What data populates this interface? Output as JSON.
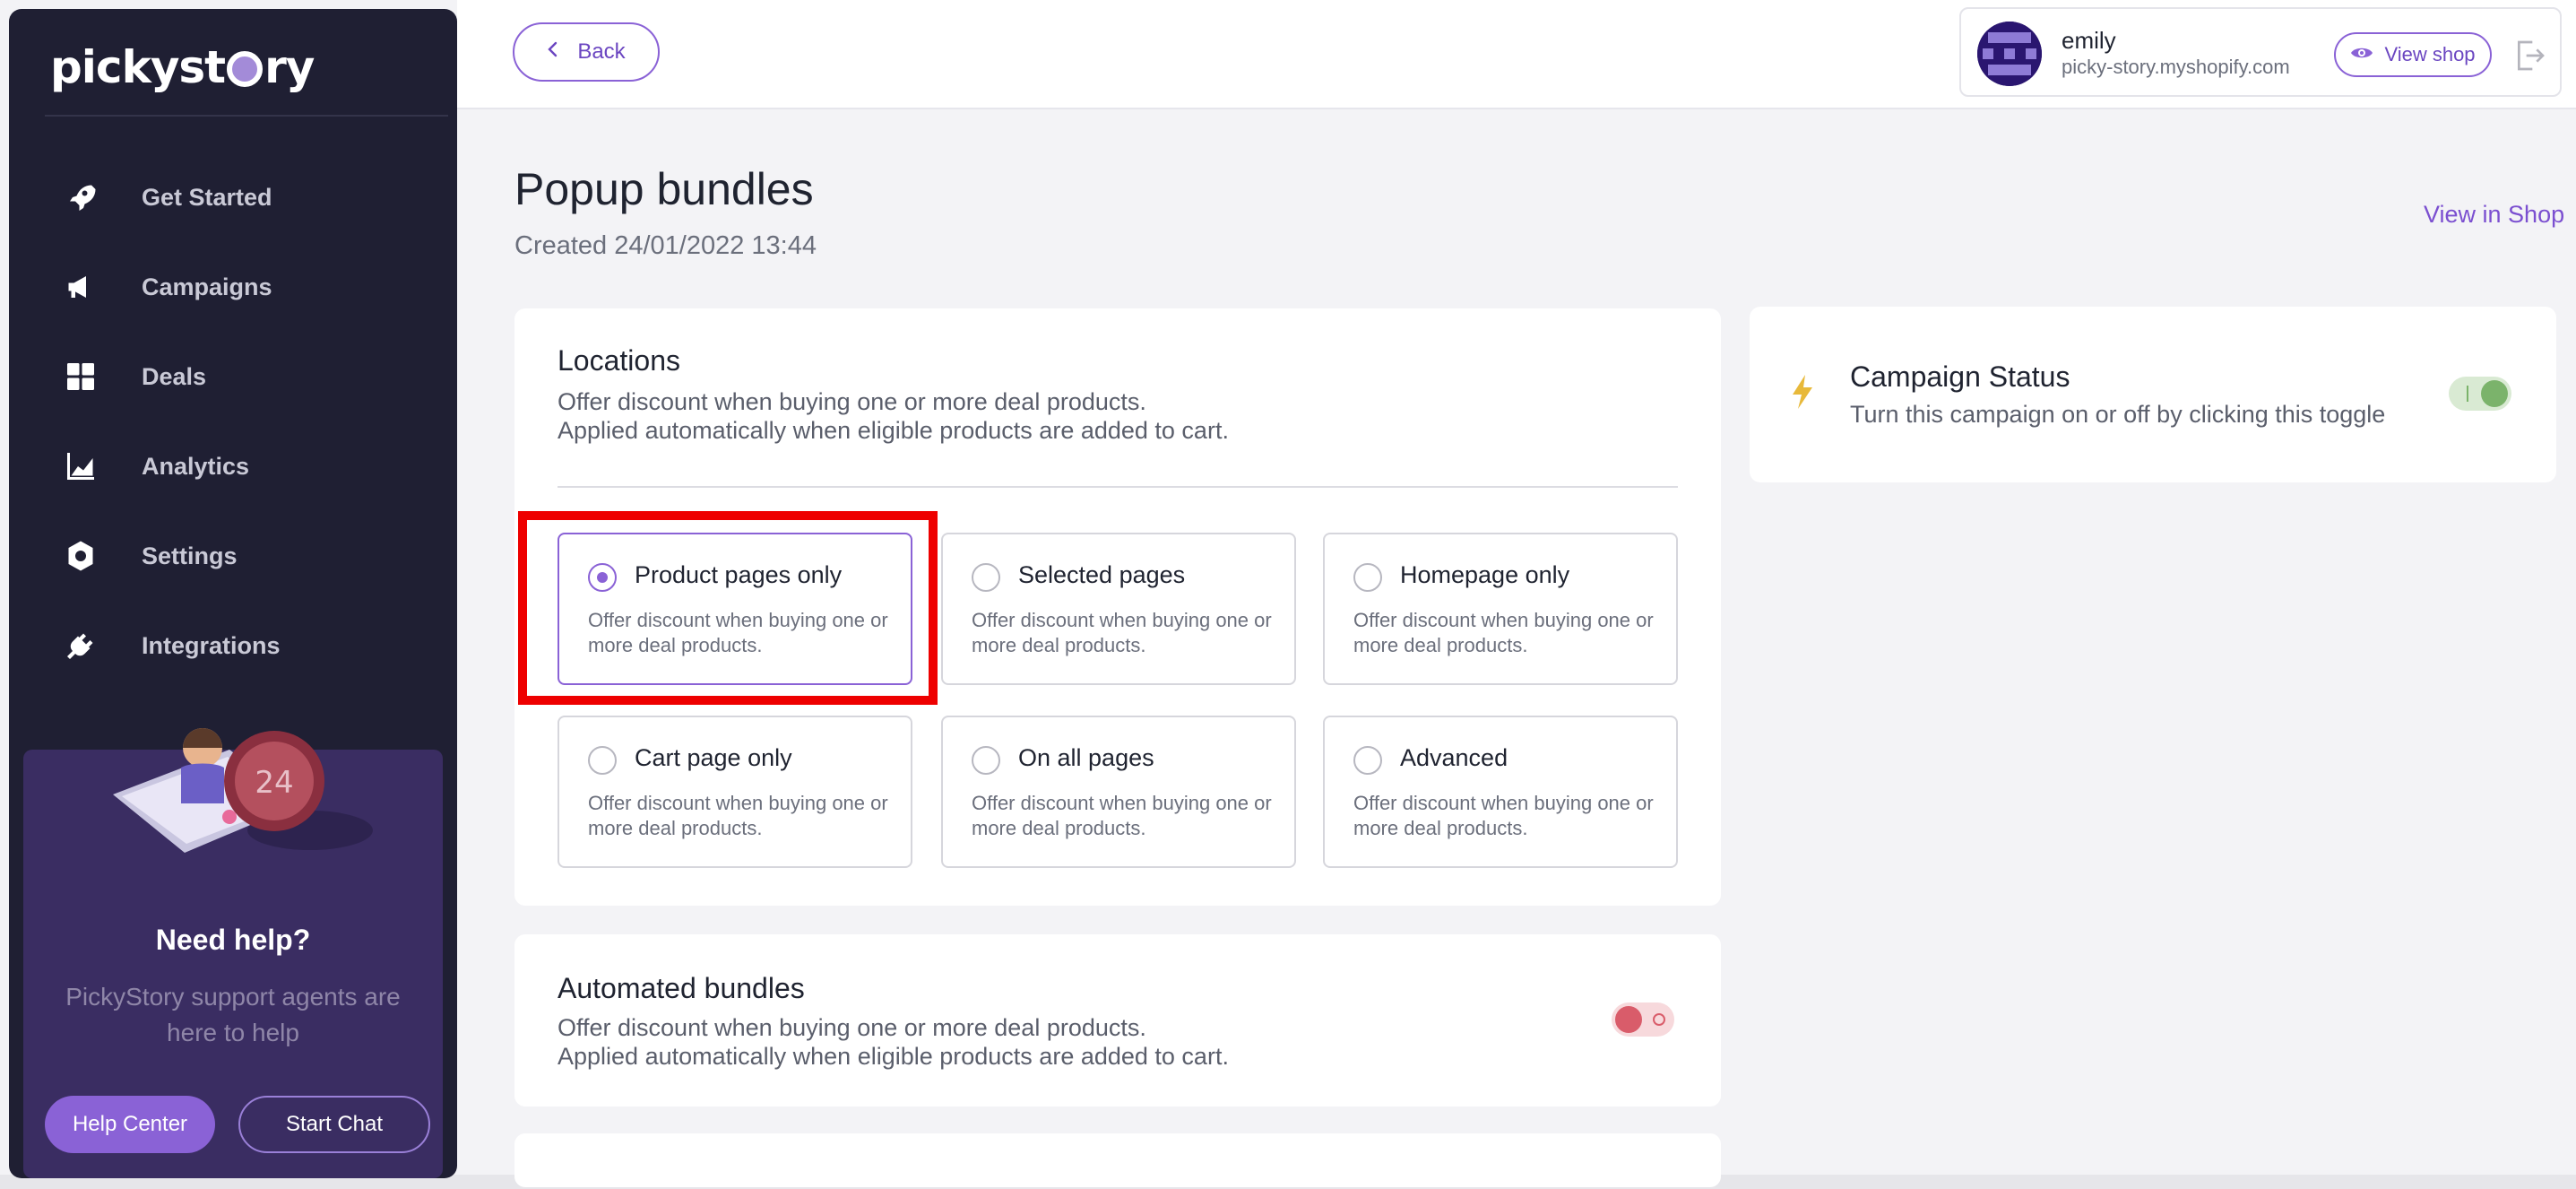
{
  "app": {
    "logo_text_left": "pickyst",
    "logo_text_right": "ry"
  },
  "sidebar": {
    "items": [
      {
        "label": "Get Started",
        "icon": "rocket-icon"
      },
      {
        "label": "Campaigns",
        "icon": "megaphone-icon"
      },
      {
        "label": "Deals",
        "icon": "grid-icon"
      },
      {
        "label": "Analytics",
        "icon": "chart-icon"
      },
      {
        "label": "Settings",
        "icon": "gear-icon"
      },
      {
        "label": "Integrations",
        "icon": "plug-icon"
      }
    ],
    "help": {
      "title": "Need help?",
      "subtitle": "PickyStory support agents are here to help",
      "help_center_label": "Help Center",
      "start_chat_label": "Start Chat"
    }
  },
  "header": {
    "back_label": "Back",
    "user": {
      "name": "emily",
      "shop": "picky-story.myshopify.com",
      "view_shop_label": "View shop"
    }
  },
  "page": {
    "title": "Popup bundles",
    "created": "Created 24/01/2022 13:44",
    "view_in_shop_label": "View in Shop"
  },
  "locations": {
    "title": "Locations",
    "desc_line1": "Offer discount when buying one or more deal products.",
    "desc_line2": "Applied automatically when eligible products are added to cart.",
    "options": [
      {
        "title": "Product pages only",
        "desc": "Offer discount when buying one or more deal products.",
        "selected": true
      },
      {
        "title": "Selected pages",
        "desc": "Offer discount when buying one or more deal products.",
        "selected": false
      },
      {
        "title": "Homepage only",
        "desc": "Offer discount when buying one or more deal products.",
        "selected": false
      },
      {
        "title": "Cart page only",
        "desc": "Offer discount when buying one or more deal products.",
        "selected": false
      },
      {
        "title": "On all pages",
        "desc": "Offer discount when buying one or more deal products.",
        "selected": false
      },
      {
        "title": "Advanced",
        "desc": "Offer discount when buying one or more deal products.",
        "selected": false
      }
    ]
  },
  "automated_bundles": {
    "title": "Automated bundles",
    "desc_line1": "Offer discount when buying one or more deal products.",
    "desc_line2": "Applied automatically when eligible products are added to cart.",
    "enabled": false
  },
  "campaign_status": {
    "title": "Campaign Status",
    "desc": "Turn this campaign on or off by clicking this toggle",
    "enabled": true
  },
  "colors": {
    "accent": "#8a62d6",
    "sidebar_bg": "#1f1f33",
    "highlight": "#ee0000",
    "toggle_on": "#7bb36b",
    "toggle_off": "#d95c6a"
  }
}
